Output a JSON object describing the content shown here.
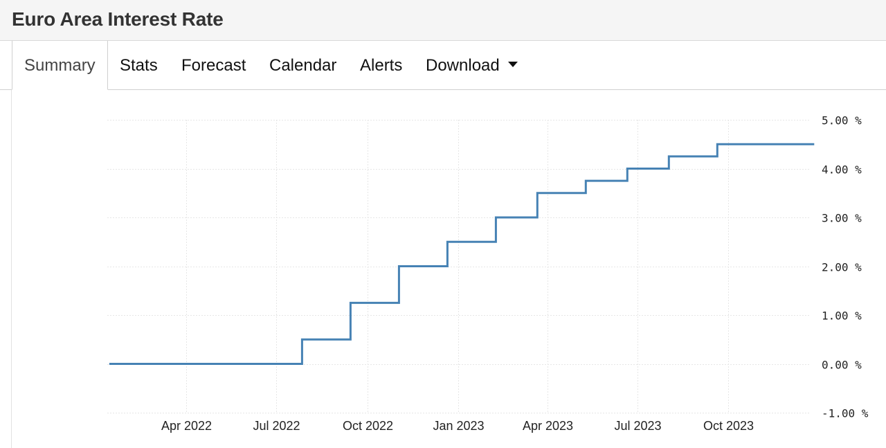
{
  "page": {
    "title": "Euro Area Interest Rate"
  },
  "tabs": [
    {
      "label": "Summary",
      "active": true
    },
    {
      "label": "Stats",
      "active": false
    },
    {
      "label": "Forecast",
      "active": false
    },
    {
      "label": "Calendar",
      "active": false
    },
    {
      "label": "Alerts",
      "active": false
    },
    {
      "label": "Download",
      "active": false,
      "has_dropdown": true
    }
  ],
  "colors": {
    "line": "#4682b4",
    "grid": "#e6e6e6",
    "title_bar": "#f5f5f5"
  },
  "chart_data": {
    "type": "line",
    "step": true,
    "title": "",
    "xlabel": "",
    "ylabel": "",
    "ylim": [
      -1.0,
      5.0
    ],
    "xlim": [
      "2022-01-11",
      "2023-12-31"
    ],
    "yticks": [
      {
        "value": 5,
        "label": "5.00 %"
      },
      {
        "value": 4,
        "label": "4.00 %"
      },
      {
        "value": 3,
        "label": "3.00 %"
      },
      {
        "value": 2,
        "label": "2.00 %"
      },
      {
        "value": 1,
        "label": "1.00 %"
      },
      {
        "value": 0,
        "label": "0.00 %"
      },
      {
        "value": -1,
        "label": "-1.00 %"
      }
    ],
    "xticks": [
      {
        "date": "2022-04-01",
        "label": "Apr 2022"
      },
      {
        "date": "2022-07-01",
        "label": "Jul 2022"
      },
      {
        "date": "2022-10-01",
        "label": "Oct 2022"
      },
      {
        "date": "2023-01-01",
        "label": "Jan 2023"
      },
      {
        "date": "2023-04-01",
        "label": "Apr 2023"
      },
      {
        "date": "2023-07-01",
        "label": "Jul 2023"
      },
      {
        "date": "2023-10-01",
        "label": "Oct 2023"
      }
    ],
    "grid": true,
    "legend": "none",
    "series": [
      {
        "points": [
          {
            "x": "2022-01-13",
            "y": 0.0
          },
          {
            "x": "2022-07-27",
            "y": 0.5
          },
          {
            "x": "2022-09-14",
            "y": 1.25
          },
          {
            "x": "2022-11-02",
            "y": 2.0
          },
          {
            "x": "2022-12-21",
            "y": 2.5
          },
          {
            "x": "2023-02-08",
            "y": 3.0
          },
          {
            "x": "2023-03-22",
            "y": 3.5
          },
          {
            "x": "2023-05-10",
            "y": 3.75
          },
          {
            "x": "2023-06-21",
            "y": 4.0
          },
          {
            "x": "2023-08-02",
            "y": 4.25
          },
          {
            "x": "2023-09-20",
            "y": 4.5
          },
          {
            "x": "2023-12-27",
            "y": 4.5
          }
        ]
      }
    ]
  }
}
